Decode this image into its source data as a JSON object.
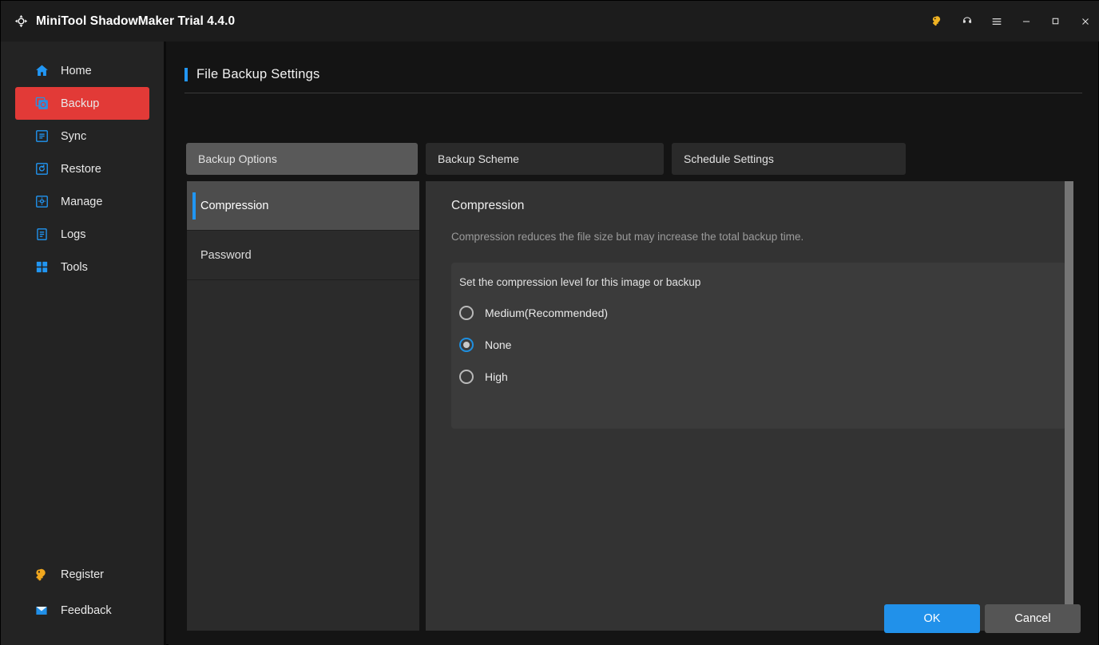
{
  "window": {
    "title": "MiniTool ShadowMaker Trial 4.4.0",
    "logo_icon": "shadowmaker-logo-icon",
    "controls": [
      {
        "name": "register-key-icon",
        "glyph": "key"
      },
      {
        "name": "support-headset-icon",
        "glyph": "headset"
      },
      {
        "name": "menu-hamburger-icon",
        "glyph": "menu"
      },
      {
        "name": "minimize-icon",
        "glyph": "minimize"
      },
      {
        "name": "maximize-icon",
        "glyph": "maximize"
      },
      {
        "name": "close-icon",
        "glyph": "close"
      }
    ]
  },
  "colors": {
    "accent_blue": "#2196f3",
    "active_red": "#e23a37",
    "ok_blue": "#2191ea",
    "key_yellow": "#f0a71e",
    "panel": "#333333",
    "option_box": "#3b3b3b",
    "sidebar": "#232323",
    "app_bg": "#141414"
  },
  "sidebar": {
    "items": [
      {
        "label": "Home",
        "icon": "home-icon",
        "active": false
      },
      {
        "label": "Backup",
        "icon": "backup-icon",
        "active": true
      },
      {
        "label": "Sync",
        "icon": "sync-icon",
        "active": false
      },
      {
        "label": "Restore",
        "icon": "restore-icon",
        "active": false
      },
      {
        "label": "Manage",
        "icon": "manage-gear-icon",
        "active": false
      },
      {
        "label": "Logs",
        "icon": "logs-clipboard-icon",
        "active": false
      },
      {
        "label": "Tools",
        "icon": "tools-grid-icon",
        "active": false
      }
    ],
    "bottom_items": [
      {
        "label": "Register",
        "icon": "key-icon"
      },
      {
        "label": "Feedback",
        "icon": "envelope-icon"
      }
    ]
  },
  "page": {
    "title": "File Backup Settings"
  },
  "tabs": [
    {
      "label": "Backup Options",
      "active": true
    },
    {
      "label": "Backup Scheme",
      "active": false
    },
    {
      "label": "Schedule Settings",
      "active": false
    }
  ],
  "sublist": [
    {
      "label": "Compression",
      "active": true
    },
    {
      "label": "Password",
      "active": false
    }
  ],
  "content": {
    "title": "Compression",
    "description": "Compression reduces the file size but may increase the total backup time.",
    "group_label": "Set the compression level for this image or backup",
    "options": [
      {
        "label": "Medium(Recommended)",
        "checked": false
      },
      {
        "label": "None",
        "checked": true
      },
      {
        "label": "High",
        "checked": false
      }
    ]
  },
  "footer": {
    "ok_label": "OK",
    "cancel_label": "Cancel"
  }
}
